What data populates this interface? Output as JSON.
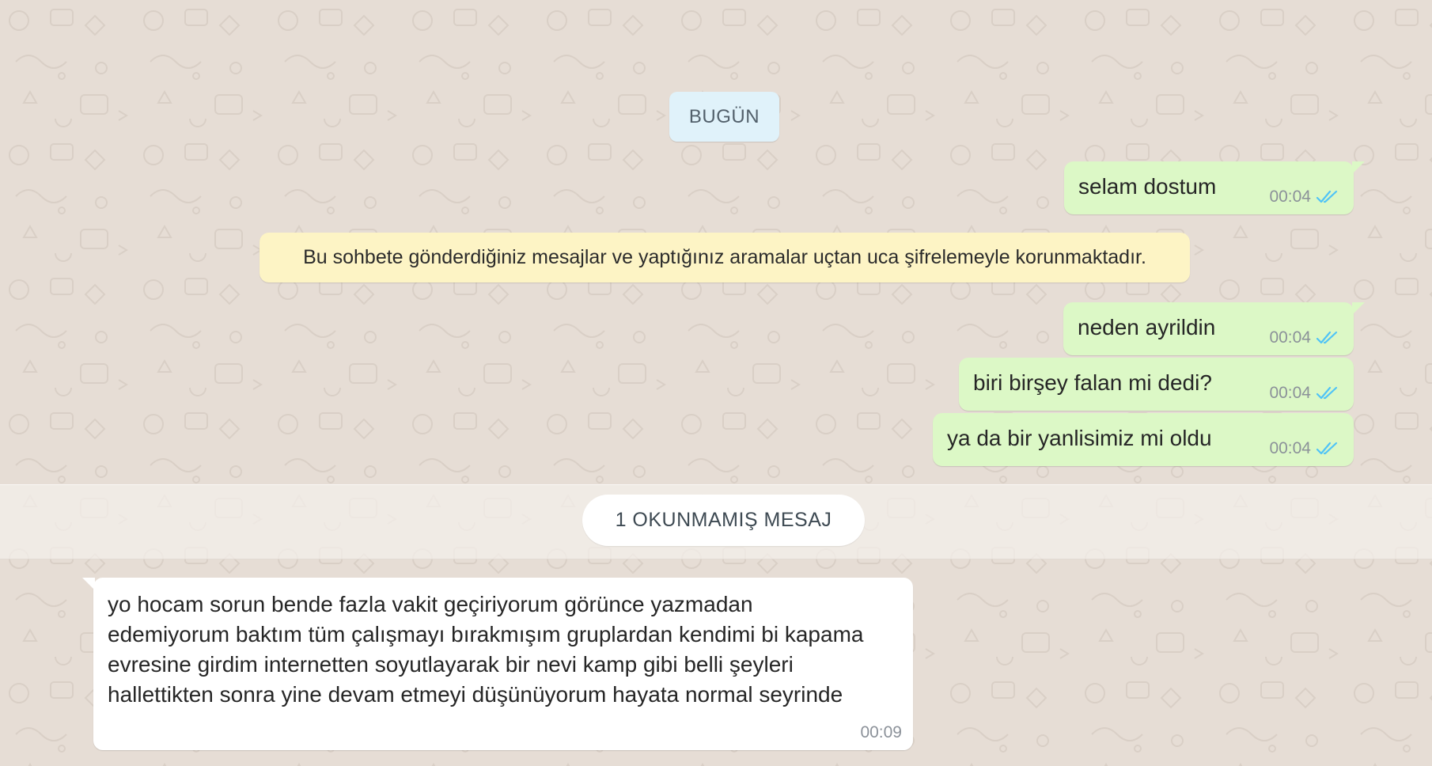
{
  "date_divider": "BUGÜN",
  "messages": [
    {
      "text": "selam dostum",
      "time": "00:04"
    },
    {
      "text": "neden ayrildin",
      "time": "00:04"
    },
    {
      "text": "biri birşey falan mi dedi?",
      "time": "00:04"
    },
    {
      "text": "ya da bir yanlisimiz mi oldu",
      "time": "00:04"
    }
  ],
  "encryption_notice": "Bu sohbete gönderdiğiniz mesajlar ve yaptığınız aramalar uçtan uca şifrelemeyle korunmaktadır.",
  "unread_divider": "1 OKUNMAMIŞ MESAJ",
  "incoming": {
    "text": "yo hocam sorun bende fazla vakit geçiriyorum görünce yazmadan\nedemiyorum baktım tüm çalışmayı bırakmışım gruplardan kendimi bi kapama\nevresine girdim internetten soyutlayarak bir nevi kamp gibi belli şeyleri\nhallettikten sonra yine devam etmeyi düşünüyorum hayata normal seyrinde",
    "time": "00:09"
  },
  "colors": {
    "background": "#e6ddd5",
    "outgoing_bubble": "#dcf8c6",
    "incoming_bubble": "#ffffff",
    "date_pill": "#e0f2fa",
    "notice_pill": "#fdf4c5",
    "read_ticks": "#4fc3f7"
  },
  "icons": {
    "read_receipt": "double-check-icon"
  }
}
